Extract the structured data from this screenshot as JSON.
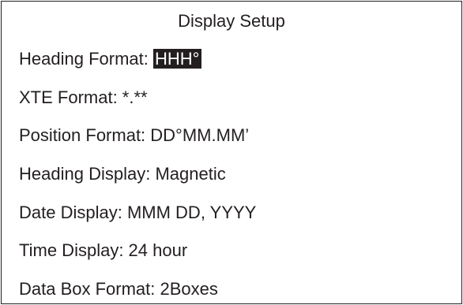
{
  "screen": {
    "title": "Display Setup"
  },
  "settings": [
    {
      "label": "Heading Format: ",
      "value": "HHH°"
    },
    {
      "label": "XTE Format: ",
      "value": "*.**"
    },
    {
      "label": "Position Format: ",
      "value": "DD°MM.MM’"
    },
    {
      "label": "Heading Display: ",
      "value": "Magnetic"
    },
    {
      "label": "Date Display: ",
      "value": "MMM DD, YYYY"
    },
    {
      "label": "Time Display: ",
      "value": "24 hour"
    },
    {
      "label": "Data Box Format: ",
      "value": "2Boxes"
    }
  ],
  "selection": {
    "selected_index": 0
  },
  "colors": {
    "foreground": "#231f20",
    "background": "#ffffff",
    "highlight_text": "#ffffff"
  }
}
